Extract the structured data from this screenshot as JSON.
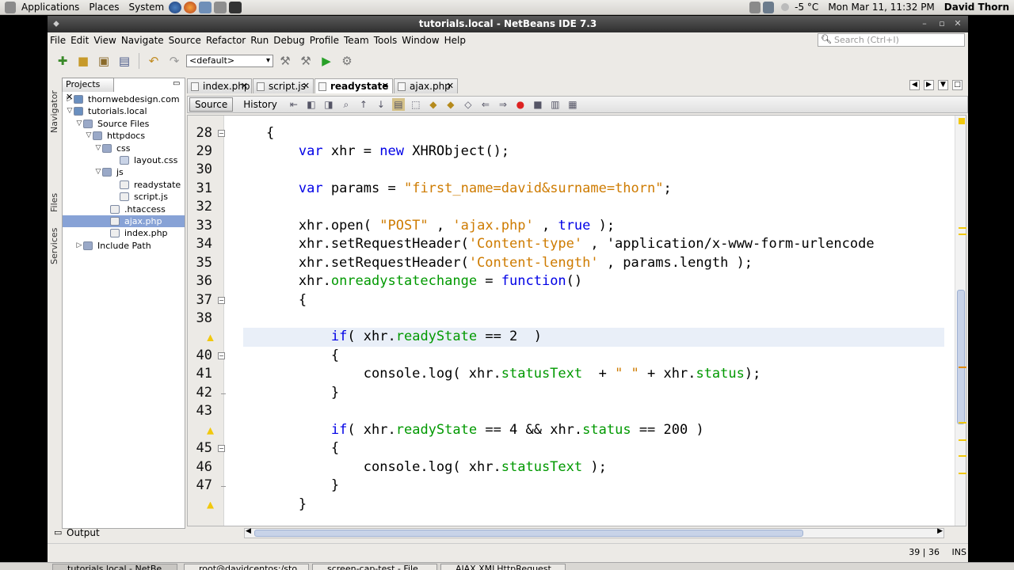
{
  "panel": {
    "applications": "Applications",
    "places": "Places",
    "system": "System",
    "temperature": "-5 °C",
    "datetime": "Mon Mar 11, 11:32 PM",
    "user": "David Thorn"
  },
  "window": {
    "title": "tutorials.local - NetBeans IDE 7.3"
  },
  "menu": [
    "File",
    "Edit",
    "View",
    "Navigate",
    "Source",
    "Refactor",
    "Run",
    "Debug",
    "Profile",
    "Team",
    "Tools",
    "Window",
    "Help"
  ],
  "search": {
    "placeholder": "Search (Ctrl+I)"
  },
  "toolbar": {
    "config": "<default>"
  },
  "projects": {
    "tab_label": "Projects",
    "side_tabs": [
      "Navigator",
      "Files",
      "Services"
    ],
    "tree": [
      {
        "label": "thornwebdesign.com",
        "selected": false
      },
      {
        "label": "tutorials.local",
        "selected": false
      },
      {
        "label": "Source Files",
        "selected": false
      },
      {
        "label": "httpdocs",
        "selected": false
      },
      {
        "label": "css",
        "selected": false
      },
      {
        "label": "layout.css",
        "selected": false
      },
      {
        "label": "js",
        "selected": false
      },
      {
        "label": "readystate",
        "selected": false
      },
      {
        "label": "script.js",
        "selected": false
      },
      {
        "label": ".htaccess",
        "selected": false
      },
      {
        "label": "ajax.php",
        "selected": true
      },
      {
        "label": "index.php",
        "selected": false
      },
      {
        "label": "Include Path",
        "selected": false
      }
    ]
  },
  "editor": {
    "tabs": [
      {
        "label": "index.php",
        "active": false
      },
      {
        "label": "script.js",
        "active": false
      },
      {
        "label": "readystate",
        "active": true
      },
      {
        "label": "ajax.php",
        "active": false
      }
    ],
    "source_label": "Source",
    "history_label": "History",
    "lines": [
      {
        "n": "28",
        "text": "    {"
      },
      {
        "n": "29",
        "text": "        var xhr = new XHRObject();"
      },
      {
        "n": "30",
        "text": ""
      },
      {
        "n": "31",
        "text": "        var params = \"first_name=david&surname=thorn\";"
      },
      {
        "n": "32",
        "text": ""
      },
      {
        "n": "33",
        "text": "        xhr.open( \"POST\" , 'ajax.php' , true );"
      },
      {
        "n": "34",
        "text": "        xhr.setRequestHeader('Content-type' , 'application/x-www-form-urlencode"
      },
      {
        "n": "35",
        "text": "        xhr.setRequestHeader('Content-length' , params.length );"
      },
      {
        "n": "36",
        "text": "        xhr.onreadystatechange = function()"
      },
      {
        "n": "37",
        "text": "        {"
      },
      {
        "n": "38",
        "text": ""
      },
      {
        "n": "",
        "text": "            if( xhr.readyState == 2  )"
      },
      {
        "n": "40",
        "text": "            {"
      },
      {
        "n": "41",
        "text": "                console.log( xhr.statusText  + \" \" + xhr.status);"
      },
      {
        "n": "42",
        "text": "            }"
      },
      {
        "n": "43",
        "text": ""
      },
      {
        "n": "",
        "text": "            if( xhr.readyState == 4 && xhr.status == 200 )"
      },
      {
        "n": "45",
        "text": "            {"
      },
      {
        "n": "46",
        "text": "                console.log( xhr.statusText );"
      },
      {
        "n": "47",
        "text": "            }"
      },
      {
        "n": "",
        "text": "        }"
      }
    ]
  },
  "output": {
    "label": "Output"
  },
  "status": {
    "position": "39 | 36",
    "mode": "INS"
  },
  "taskbar": [
    "tutorials.local - NetBe...",
    "root@davidcentos:/sto...",
    "screen-cap-test - File ...",
    "AJAX XMLHttpRequest ..."
  ],
  "colors": {
    "keyword": "#0000e6",
    "string": "#ce7b00",
    "property": "#009900",
    "selection": "#87a2d6"
  }
}
